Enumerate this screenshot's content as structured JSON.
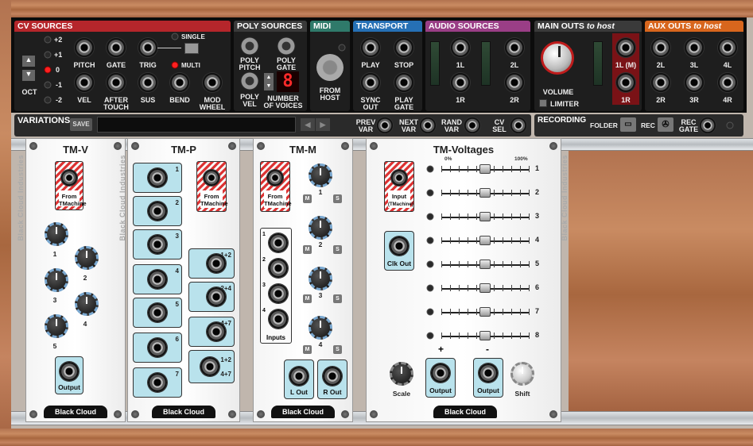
{
  "host": {
    "cv_sources": {
      "title": "CV SOURCES",
      "octave_values": [
        "+2",
        "+1",
        "0",
        "-1",
        "-2"
      ],
      "octave_label": "OCT",
      "jacks_row1": [
        "PITCH",
        "GATE",
        "TRIG"
      ],
      "jacks_row2": [
        "VEL",
        "AFTER TOUCH",
        "SUS",
        "BEND",
        "MOD WHEEL"
      ],
      "single": "SINGLE",
      "multi": "MULTI"
    },
    "poly_sources": {
      "title": "POLY SOURCES",
      "poly_pitch": "POLY PITCH",
      "poly_gate": "POLY GATE",
      "poly_vel": "POLY VEL",
      "number_of_voices": "NUMBER OF VOICES",
      "voices_value": "8"
    },
    "midi": {
      "title": "MIDI",
      "from_host": "FROM HOST"
    },
    "transport": {
      "title": "TRANSPORT",
      "play": "PLAY",
      "stop": "STOP",
      "sync_out": "SYNC OUT",
      "play_gate": "PLAY GATE"
    },
    "audio_sources": {
      "title": "AUDIO SOURCES",
      "labels": [
        "1L",
        "2L",
        "1R",
        "2R"
      ]
    },
    "main_outs": {
      "title": "MAIN OUTS",
      "suffix": "to host",
      "volume": "VOLUME",
      "limiter": "LIMITER",
      "l_label": "1L (M)",
      "r_label": "1R"
    },
    "aux_outs": {
      "title": "AUX OUTS",
      "suffix": "to host",
      "labels": [
        "2L",
        "3L",
        "4L",
        "2R",
        "3R",
        "4R"
      ]
    },
    "variations": {
      "title": "VARIATIONS",
      "save": "SAVE",
      "prev": "PREV VAR",
      "next": "NEXT VAR",
      "rand": "RAND VAR",
      "cv_sel": "CV SEL"
    },
    "recording": {
      "title": "RECORDING",
      "folder": "FOLDER",
      "rec": "REC",
      "rec_gate": "REC GATE"
    }
  },
  "modules": {
    "tmv": {
      "title": "TM-V",
      "brand": "Black Cloud Industries",
      "from": "From TMachine",
      "knobs": [
        "1",
        "2",
        "3",
        "4",
        "5"
      ],
      "output": "Output",
      "logo": "Black Cloud"
    },
    "tmp": {
      "title": "TM-P",
      "brand": "Black Cloud Industries",
      "from": "From TMachine",
      "inputs": [
        "1",
        "2",
        "3",
        "4",
        "5",
        "6",
        "7"
      ],
      "outputs": [
        "1+2",
        "2+4",
        "4+7",
        "1+2 4+7"
      ],
      "logo": "Black Cloud"
    },
    "tmm": {
      "title": "TM-M",
      "from": "From TMachine",
      "knobs": [
        "1",
        "2",
        "3",
        "4"
      ],
      "inputs": [
        "1",
        "2",
        "3",
        "4"
      ],
      "inputs_label": "Inputs",
      "l_out": "L Out",
      "r_out": "R Out",
      "logo": "Black Cloud"
    },
    "tmvolt": {
      "title": "TM-Voltages",
      "brand": "Black Cloud Industries",
      "input": "Input",
      "input_sub": "(TMachine)",
      "clk": "Clk Out",
      "pct0": "0%",
      "pct100": "100%",
      "sliders": [
        "1",
        "2",
        "3",
        "4",
        "5",
        "6",
        "7",
        "8"
      ],
      "slider_values": [
        0.5,
        0.5,
        0.5,
        0.5,
        0.5,
        0.5,
        0.5,
        0.5
      ],
      "plus": "+",
      "minus": "-",
      "scale": "Scale",
      "output": "Output",
      "shift": "Shift",
      "logo": "Black Cloud"
    }
  }
}
